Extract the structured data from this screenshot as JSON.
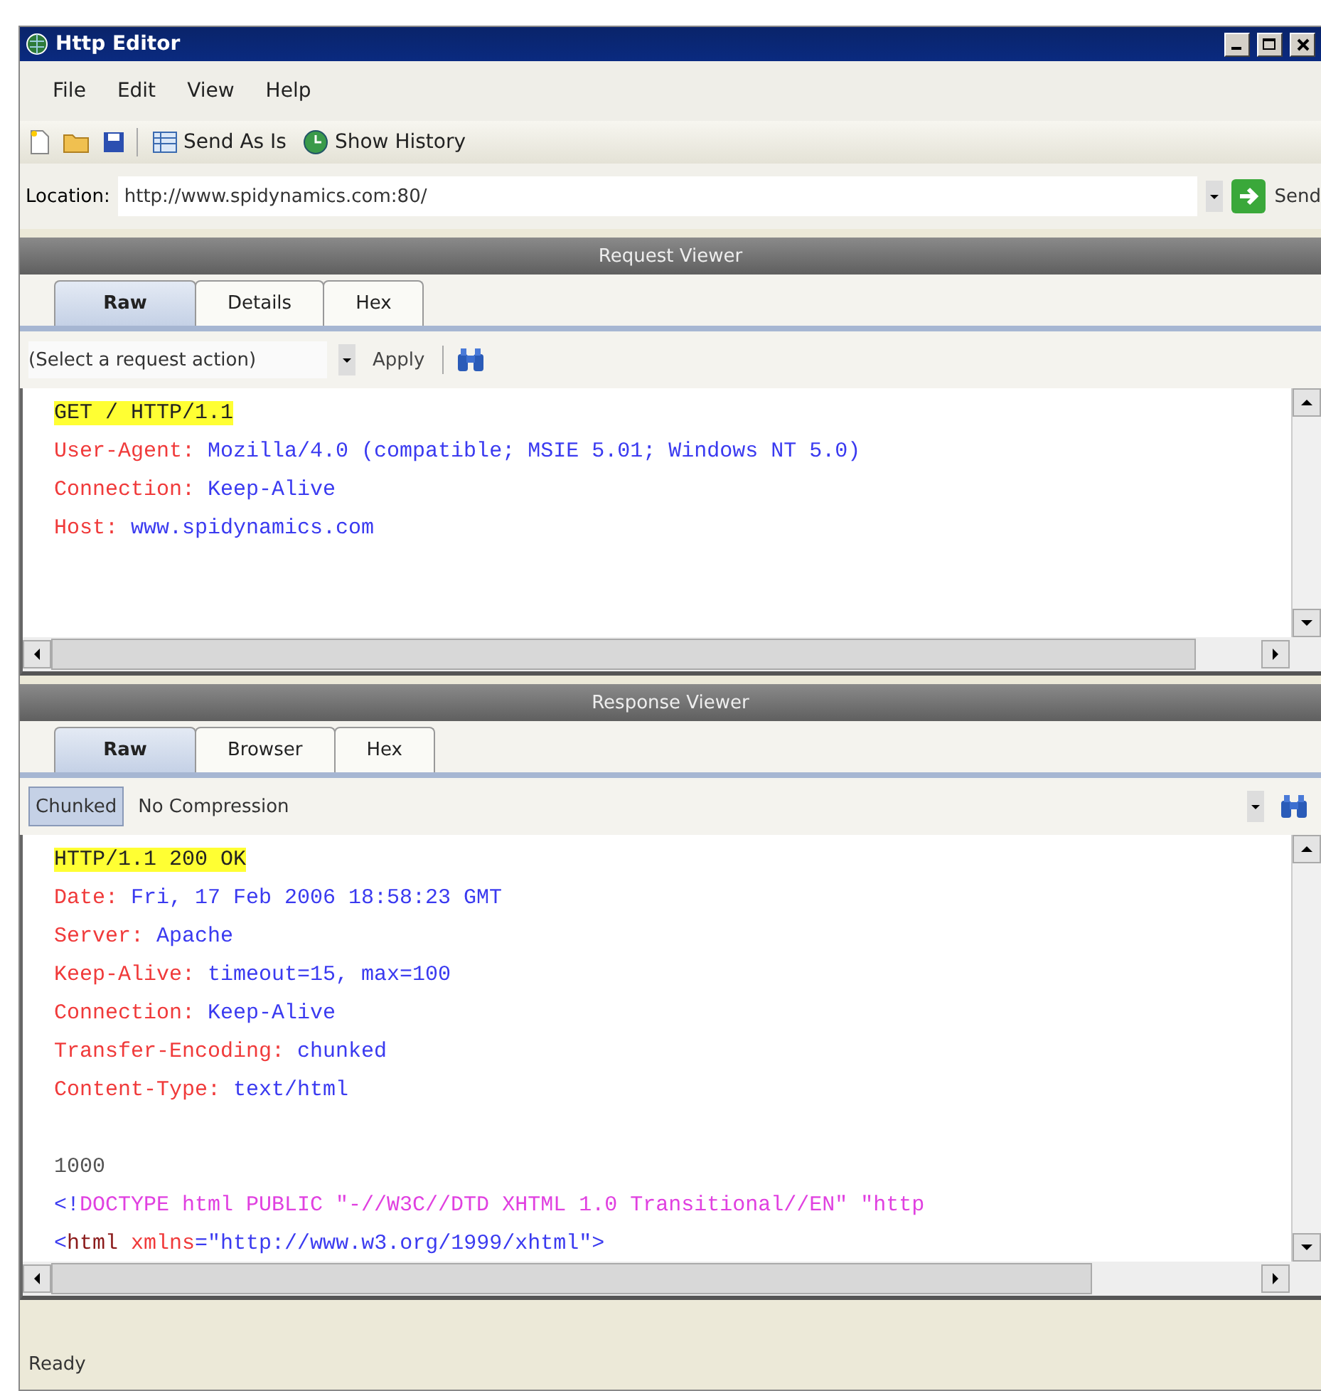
{
  "window": {
    "title": "Http Editor"
  },
  "menu": [
    "File",
    "Edit",
    "View",
    "Help"
  ],
  "toolbar": {
    "send_as_is": "Send As Is",
    "show_history": "Show History"
  },
  "location": {
    "label": "Location:",
    "value": "http://www.spidynamics.com:80/",
    "send": "Send"
  },
  "request": {
    "title": "Request Viewer",
    "tabs": [
      {
        "label": "Raw",
        "selected": true
      },
      {
        "label": "Details",
        "selected": false
      },
      {
        "label": "Hex",
        "selected": false
      }
    ],
    "action": {
      "value": "(Select a request action)",
      "apply": "Apply"
    },
    "lines": [
      [
        {
          "kind": "status",
          "text": "GET / HTTP/1.1"
        }
      ],
      [
        {
          "kind": "name",
          "text": "User-Agent: "
        },
        {
          "kind": "value",
          "text": "Mozilla/4.0 (compatible; MSIE 5.01; Windows NT 5.0)"
        }
      ],
      [
        {
          "kind": "name",
          "text": "Connection: "
        },
        {
          "kind": "value",
          "text": "Keep-Alive"
        }
      ],
      [
        {
          "kind": "name",
          "text": "Host: "
        },
        {
          "kind": "value",
          "text": "www.spidynamics.com"
        }
      ]
    ]
  },
  "response": {
    "title": "Response Viewer",
    "tabs": [
      {
        "label": "Raw",
        "selected": true
      },
      {
        "label": "Browser",
        "selected": false
      },
      {
        "label": "Hex",
        "selected": false
      }
    ],
    "chunked": {
      "label": "Chunked",
      "selected": true
    },
    "compression": "No Compression",
    "lines": [
      [
        {
          "kind": "status",
          "text": "HTTP/1.1 200 OK"
        }
      ],
      [
        {
          "kind": "name",
          "text": "Date: "
        },
        {
          "kind": "value",
          "text": "Fri, 17 Feb 2006 18:58:23 GMT"
        }
      ],
      [
        {
          "kind": "name",
          "text": "Server: "
        },
        {
          "kind": "value",
          "text": "Apache"
        }
      ],
      [
        {
          "kind": "name",
          "text": "Keep-Alive: "
        },
        {
          "kind": "value",
          "text": "timeout=15, max=100"
        }
      ],
      [
        {
          "kind": "name",
          "text": "Connection: "
        },
        {
          "kind": "value",
          "text": "Keep-Alive"
        }
      ],
      [
        {
          "kind": "name",
          "text": "Transfer-Encoding: "
        },
        {
          "kind": "value",
          "text": "chunked"
        }
      ],
      [
        {
          "kind": "name",
          "text": "Content-Type: "
        },
        {
          "kind": "value",
          "text": "text/html"
        }
      ],
      [
        {
          "kind": "plain",
          "text": "1000",
          "gap_before": true
        }
      ],
      [
        {
          "kind": "value",
          "text": "<!"
        },
        {
          "kind": "doctype",
          "text": "DOCTYPE html PUBLIC \"-//W3C//DTD XHTML 1.0 Transitional//EN\" \"http"
        }
      ],
      [
        {
          "kind": "value",
          "text": "<"
        },
        {
          "kind": "tag",
          "text": "html"
        },
        {
          "kind": "name",
          "text": " xmlns"
        },
        {
          "kind": "value",
          "text": "=\"http://www.w3.org/1999/xhtml\">"
        }
      ]
    ]
  },
  "status_bar": "Ready"
}
